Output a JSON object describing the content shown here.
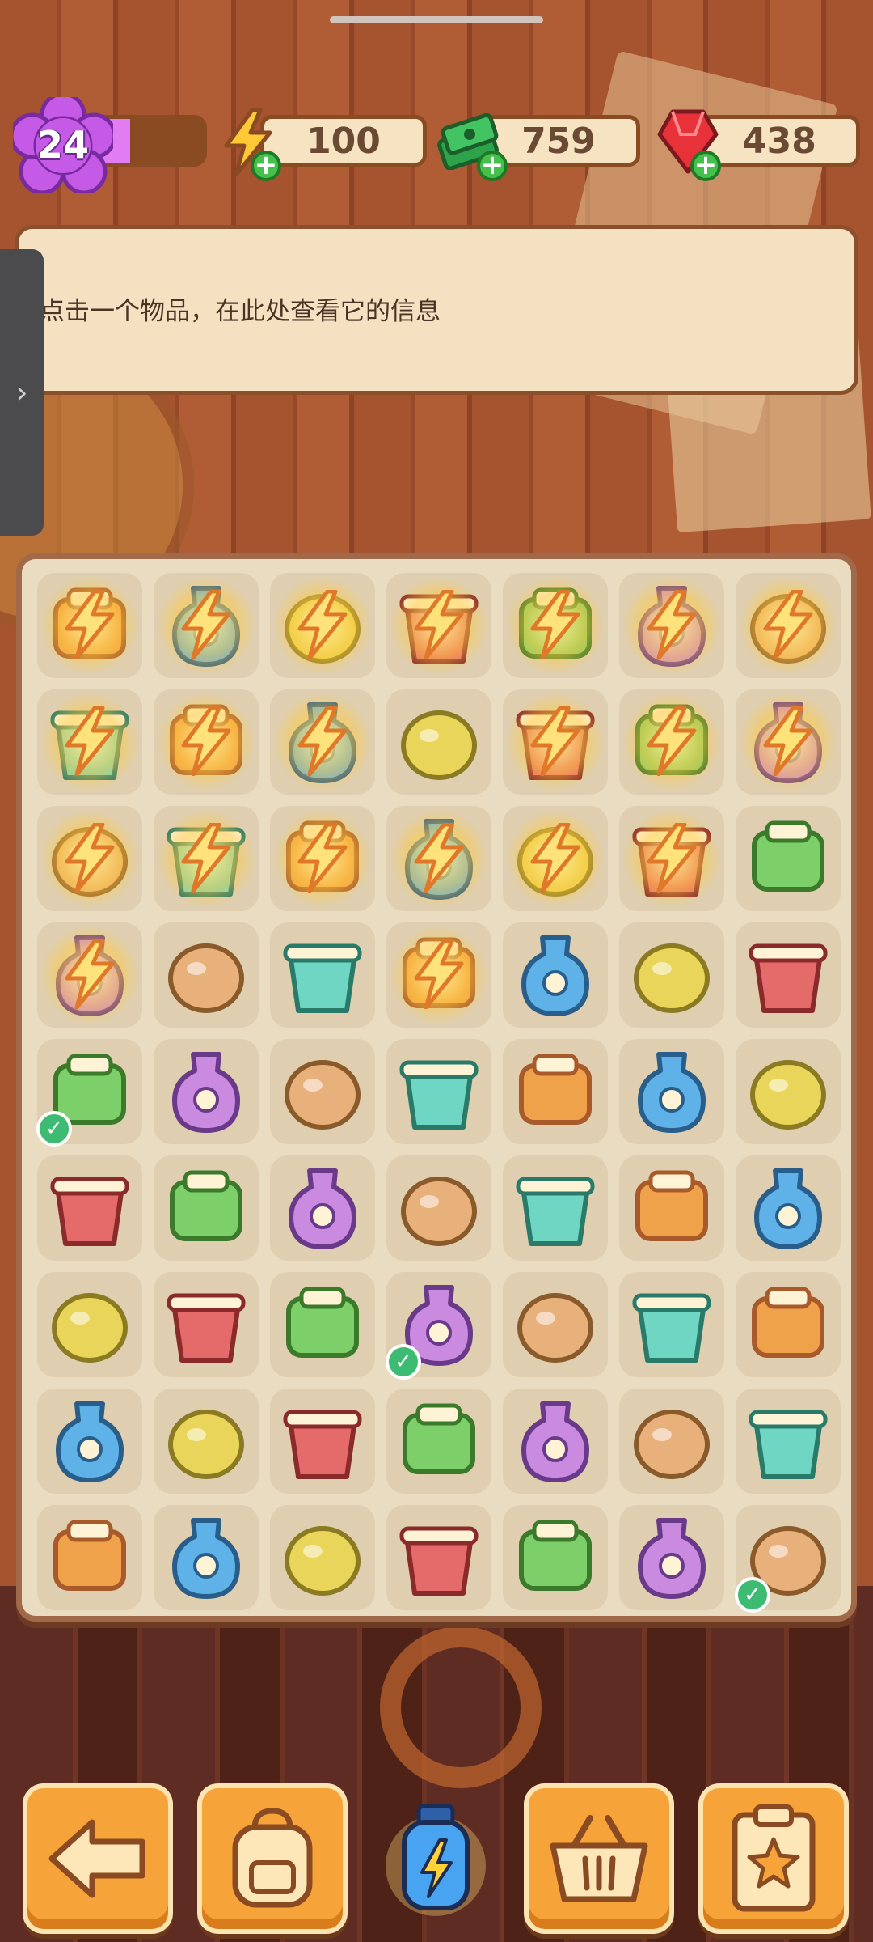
{
  "header": {
    "level": "24",
    "level_progress": 0.3,
    "energy": "100",
    "cash": "759",
    "gems": "438"
  },
  "info_panel": {
    "text": "点击一个物品，在此处查看它的信息"
  },
  "side_tab": {
    "icon": "chevron-right-icon",
    "glyph": "›"
  },
  "board": {
    "rows": 9,
    "cols": 7,
    "items": [
      [
        "gloves-box-icon",
        "lantern-bag-icon",
        "cash-box-icon",
        "car-bag-icon",
        "potted-plant-icon",
        "wardrobe-icon",
        "vase-box-icon"
      ],
      [
        "bag-red-icon",
        "bag-red-icon",
        "jeep-icon",
        "mortar-pestle-icon",
        "photo-frame-icon",
        "house-box-icon",
        "plant-pot-icon"
      ],
      [
        "scroll-bag-icon",
        "tablet-icon",
        "potion-kit-icon",
        "potion-kit-icon",
        "potion-kit-icon",
        "potion-kit-icon",
        "bicycle-icon"
      ],
      [
        "heart-bag-icon",
        "blue-vase-icon",
        "orange-vase-icon",
        "atv-icon",
        "clay-pot-icon",
        "painted-vase-icon",
        "bucket-icon"
      ],
      [
        "lotion-bottle-icon",
        "flower-chest-icon",
        "flower-chest-icon",
        "sponge-tray-icon",
        "footprint-bag-icon",
        "blue-disc-icon",
        "round-vase-icon"
      ],
      [
        "danger-sign-icon",
        "broom-icon",
        "green-sponge-icon",
        "red-gloves-icon",
        "evidence-bag-icon",
        "magnifier-blue-icon",
        "tires-icon"
      ],
      [
        "pet-bowl-icon",
        "hair-bow-icon",
        "star-wand-icon",
        "trowel-icon",
        "magnifying-glass-icon",
        "caution-tape-icon",
        "evidence-box-icon"
      ],
      [
        "wheel-icon",
        "soap-bottle-icon",
        "sunglasses-icon",
        "comb-icon",
        "green-headband-icon",
        "spyglass-icon",
        "wanted-poster-icon"
      ],
      [
        "plank-bench-icon",
        "pendant-icon",
        "mitten-icon",
        "brick-icon",
        "flower-pot-icon",
        "mitten-icon",
        "lotion-bottle-icon"
      ]
    ],
    "energized": [
      [
        0,
        0
      ],
      [
        0,
        1
      ],
      [
        0,
        2
      ],
      [
        0,
        3
      ],
      [
        0,
        4
      ],
      [
        0,
        5
      ],
      [
        0,
        6
      ],
      [
        1,
        0
      ],
      [
        1,
        1
      ],
      [
        1,
        2
      ],
      [
        1,
        4
      ],
      [
        1,
        5
      ],
      [
        1,
        6
      ],
      [
        2,
        0
      ],
      [
        2,
        1
      ],
      [
        2,
        2
      ],
      [
        2,
        3
      ],
      [
        2,
        4
      ],
      [
        2,
        5
      ],
      [
        3,
        0
      ],
      [
        3,
        3
      ]
    ],
    "checked": [
      [
        4,
        0
      ],
      [
        6,
        3
      ],
      [
        8,
        6
      ]
    ],
    "wide_items": [
      [
        4,
        1
      ],
      [
        4,
        2
      ]
    ]
  },
  "colors": {
    "accent_orange": "#f6a43a",
    "panel_cream": "#f3e1c2",
    "level_pink": "#e27cf3",
    "plus_green": "#45c04a"
  },
  "bottom_bar": {
    "buttons": [
      {
        "name": "back-button",
        "icon": "back-arrow-icon"
      },
      {
        "name": "backpack-button",
        "icon": "backpack-icon"
      },
      {
        "name": "energy-bottle",
        "icon": "energy-bottle-icon"
      },
      {
        "name": "shop-button",
        "icon": "basket-icon"
      },
      {
        "name": "tasks-button",
        "icon": "clipboard-star-icon"
      }
    ]
  }
}
